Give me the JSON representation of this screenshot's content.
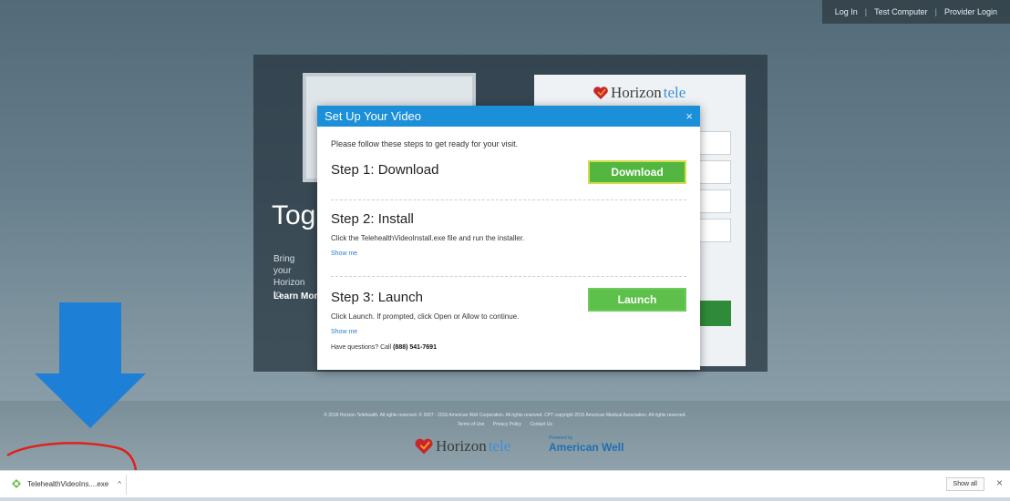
{
  "topnav": {
    "items": [
      {
        "label": "Log In"
      },
      {
        "label": "Test Computer"
      },
      {
        "label": "Provider Login"
      }
    ],
    "separator": "|"
  },
  "hero": {
    "heading": "Tog",
    "body_line1": "Bring your",
    "body_line2": "Horizon to",
    "learn_more": "Learn Mor"
  },
  "login_card": {
    "logo_left": "Horizon",
    "logo_right": "tele"
  },
  "modal": {
    "title": "Set Up Your Video",
    "close_glyph": "×",
    "intro": "Please follow these steps to get ready for your visit.",
    "steps": [
      {
        "title": "Step 1: Download",
        "button": "Download"
      },
      {
        "title": "Step 2: Install",
        "desc": "Click the TelehealthVideoInstall.exe file and run the installer.",
        "show_me": "Show me"
      },
      {
        "title": "Step 3: Launch",
        "button": "Launch",
        "desc": "Click Launch. If prompted, click Open or Allow to continue.",
        "show_me": "Show me"
      }
    ],
    "questions_prefix": "Have questions? Call ",
    "questions_phone": "(888) 541-7691"
  },
  "footer": {
    "copyright": "© 2018 Horizon Telehealth. All rights reserved.    © 2007 - 2016 American Well Corporation. All rights reserved.    CPT copyright 2015 American Medical Association. All rights reserved.",
    "links": [
      "Terms of Use",
      "Privacy Policy",
      "Contact Us"
    ],
    "logo_left": "Horizon",
    "logo_right": "tele",
    "powered_by": "Powered by",
    "powered_brand": "American Well"
  },
  "download_bar": {
    "filename": "TelehealthVideoIns....exe",
    "chevron": "^",
    "show_all": "Show all",
    "close_glyph": "×"
  },
  "colors": {
    "modal_header": "#1b8fd8",
    "button_green": "#5dc04a",
    "annotation_arrow": "#1e7fd6",
    "annotation_circle": "#e0201b",
    "brand_heart": "#c8262e"
  }
}
